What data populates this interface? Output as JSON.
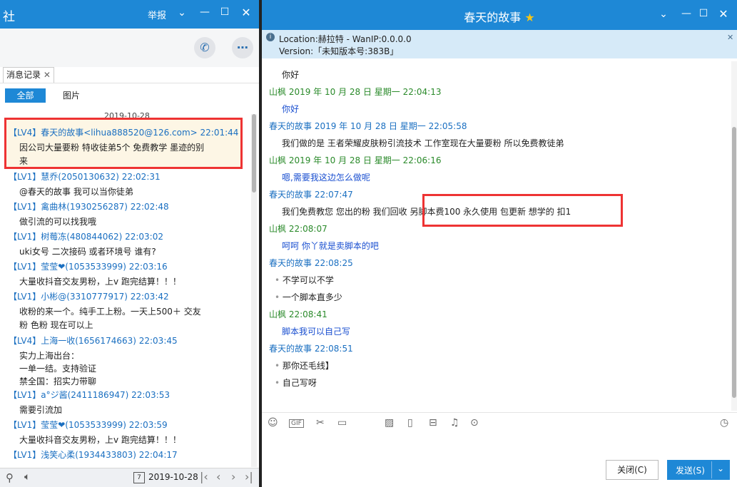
{
  "left": {
    "title": "社",
    "report_label": "举报",
    "tab_label": "消息记录",
    "filter_all": "全部",
    "filter_images": "图片",
    "date_partial": "2019-10-28",
    "messages": [
      {
        "head": "【LV4】春天的故事<lihua888520@126.com> 22:01:44",
        "body": "因公司大量要粉  特收徒弟5个  免费教学   墨迹的别",
        "body2": "来"
      },
      {
        "head": "【LV1】慧乔(2050130632) 22:02:31",
        "body": "@春天的故事 我可以当你徒弟"
      },
      {
        "head": "【LV1】禽曲林(1930256287) 22:02:48",
        "body": "做引流的可以找我哦"
      },
      {
        "head": "【LV1】树莓冻(480844062) 22:03:02",
        "body": "uki女号 二次接码    或者环境号  谁有?"
      },
      {
        "head": "【LV1】莹莹❤(1053533999) 22:03:16",
        "body": "大量收抖音交友男粉，上v  跑完结算！！！"
      },
      {
        "head": "【LV1】小彬@(3310777917) 22:03:42",
        "body": "收粉的来一个。纯手工上粉。一天上500＋ 交友",
        "body2": "粉 色粉 现在可以上"
      },
      {
        "head": "【LV4】上海一收(1656174663) 22:03:45",
        "body": "实力上海出台：",
        "body2": "一单一结。支持验证",
        "body3": "禁全国：招实力带聊"
      },
      {
        "head": "【LV1】a°ジ酱(2411186947) 22:03:53",
        "body": "需要引流加"
      },
      {
        "head": "【LV1】莹莹❤(1053533999) 22:03:59",
        "body": "大量收抖音交友男粉，上v  跑完结算！！！"
      },
      {
        "head": "【LV1】浅笑心柔(1934433803) 22:04:17",
        "body": ""
      }
    ],
    "bottom_date": "2019-10-28"
  },
  "right": {
    "title": "春天的故事",
    "location_line": "Location:赫拉特 - WanIP:0.0.0.0",
    "version_line": "Version:「未知版本号:383B」",
    "close_label": "关闭(C)",
    "send_label": "发送(S)",
    "messages": [
      {
        "kind": "msg",
        "style": "black",
        "text": "你好"
      },
      {
        "kind": "name",
        "who": "me",
        "text": "山枫 2019 年 10 月 28 日 星期一 22:04:13"
      },
      {
        "kind": "msg",
        "style": "blue",
        "text": "你好"
      },
      {
        "kind": "name",
        "who": "other",
        "text": "春天的故事 2019 年 10 月 28 日 星期一 22:05:58"
      },
      {
        "kind": "msg",
        "style": "black",
        "text": "我们做的是  王者荣耀皮肤粉引流技术  工作室现在大量要粉  所以免费教徒弟"
      },
      {
        "kind": "name",
        "who": "me",
        "text": "山枫 2019 年 10 月 28 日 星期一 22:06:16"
      },
      {
        "kind": "msg",
        "style": "blue",
        "text": "嗯,需要我这边怎么做呢"
      },
      {
        "kind": "name",
        "who": "other",
        "text": "春天的故事  22:07:47"
      },
      {
        "kind": "msg",
        "style": "black",
        "text": "我们免费教您  您出的粉 我们回收  另脚本费100 永久使用  包更新   想学的 扣1"
      },
      {
        "kind": "name",
        "who": "me",
        "text": "山枫  22:08:07"
      },
      {
        "kind": "msg",
        "style": "blue",
        "text": "呵呵 你丫就是卖脚本的吧"
      },
      {
        "kind": "name",
        "who": "other",
        "text": "春天的故事  22:08:25"
      },
      {
        "kind": "msg",
        "style": "black",
        "bullet": true,
        "text": "不学可以不学"
      },
      {
        "kind": "msg",
        "style": "black",
        "bullet": true,
        "text": "一个脚本直多少"
      },
      {
        "kind": "name",
        "who": "me",
        "text": "山枫  22:08:41"
      },
      {
        "kind": "msg",
        "style": "blue",
        "text": "脚本我可以自己写"
      },
      {
        "kind": "name",
        "who": "other",
        "text": "春天的故事  22:08:51"
      },
      {
        "kind": "msg",
        "style": "black",
        "bullet": true,
        "text": "那你还毛线】"
      },
      {
        "kind": "msg",
        "style": "black",
        "bullet": true,
        "text": "自己写呀"
      }
    ]
  }
}
